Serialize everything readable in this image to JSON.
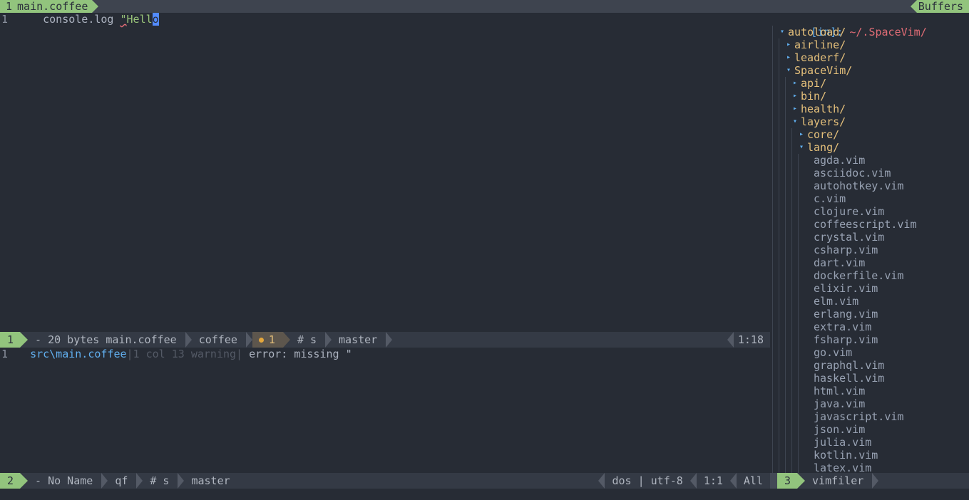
{
  "tabline": {
    "active_tab": {
      "number": "1",
      "label": "main.coffee"
    },
    "right_label": "Buffers"
  },
  "editor": {
    "lines": [
      {
        "number": "1",
        "indent": "    ",
        "code_prefix": "console.log ",
        "string_quote": "\"",
        "string_body": "Hell",
        "cursor_char": "o"
      }
    ]
  },
  "statusline_main": {
    "window_number": "1",
    "file_info": "- 20 bytes main.coffee",
    "filetype": "coffee",
    "warning_count": "1",
    "indent_info": "# s",
    "branch": "master",
    "position": "1:18"
  },
  "quickfix": {
    "lines": [
      {
        "number": "1",
        "indent": "  ",
        "file": "src\\main.coffee",
        "meta": "|1 col 13 warning|",
        "message": " error: missing \""
      }
    ]
  },
  "statusline_quickfix": {
    "window_number": "2",
    "file_info": "- No Name",
    "filetype": "qf",
    "indent_info": "# s",
    "branch": "master",
    "fileformat": "dos | utf-8",
    "position": "1:1",
    "scroll": "All"
  },
  "statusline_tree": {
    "window_number": "3",
    "label": "vimfiler"
  },
  "filetree": {
    "header_prefix": "[in]: ",
    "header_path": "~/.SpaceVim/",
    "rows": [
      {
        "depth": 0,
        "marker": "open",
        "name": "autoload/",
        "kind": "dir"
      },
      {
        "depth": 1,
        "marker": "closed",
        "name": "airline/",
        "kind": "dir"
      },
      {
        "depth": 1,
        "marker": "closed",
        "name": "leaderf/",
        "kind": "dir"
      },
      {
        "depth": 1,
        "marker": "open",
        "name": "SpaceVim/",
        "kind": "dir"
      },
      {
        "depth": 2,
        "marker": "closed",
        "name": "api/",
        "kind": "dir"
      },
      {
        "depth": 2,
        "marker": "closed",
        "name": "bin/",
        "kind": "dir"
      },
      {
        "depth": 2,
        "marker": "closed",
        "name": "health/",
        "kind": "dir"
      },
      {
        "depth": 2,
        "marker": "open",
        "name": "layers/",
        "kind": "dir"
      },
      {
        "depth": 3,
        "marker": "closed",
        "name": "core/",
        "kind": "dir"
      },
      {
        "depth": 3,
        "marker": "open",
        "name": "lang/",
        "kind": "dir"
      },
      {
        "depth": 4,
        "marker": "none",
        "name": "agda.vim",
        "kind": "file"
      },
      {
        "depth": 4,
        "marker": "none",
        "name": "asciidoc.vim",
        "kind": "file"
      },
      {
        "depth": 4,
        "marker": "none",
        "name": "autohotkey.vim",
        "kind": "file"
      },
      {
        "depth": 4,
        "marker": "none",
        "name": "c.vim",
        "kind": "file"
      },
      {
        "depth": 4,
        "marker": "none",
        "name": "clojure.vim",
        "kind": "file"
      },
      {
        "depth": 4,
        "marker": "none",
        "name": "coffeescript.vim",
        "kind": "file"
      },
      {
        "depth": 4,
        "marker": "none",
        "name": "crystal.vim",
        "kind": "file"
      },
      {
        "depth": 4,
        "marker": "none",
        "name": "csharp.vim",
        "kind": "file"
      },
      {
        "depth": 4,
        "marker": "none",
        "name": "dart.vim",
        "kind": "file"
      },
      {
        "depth": 4,
        "marker": "none",
        "name": "dockerfile.vim",
        "kind": "file"
      },
      {
        "depth": 4,
        "marker": "none",
        "name": "elixir.vim",
        "kind": "file"
      },
      {
        "depth": 4,
        "marker": "none",
        "name": "elm.vim",
        "kind": "file"
      },
      {
        "depth": 4,
        "marker": "none",
        "name": "erlang.vim",
        "kind": "file"
      },
      {
        "depth": 4,
        "marker": "none",
        "name": "extra.vim",
        "kind": "file"
      },
      {
        "depth": 4,
        "marker": "none",
        "name": "fsharp.vim",
        "kind": "file"
      },
      {
        "depth": 4,
        "marker": "none",
        "name": "go.vim",
        "kind": "file"
      },
      {
        "depth": 4,
        "marker": "none",
        "name": "graphql.vim",
        "kind": "file"
      },
      {
        "depth": 4,
        "marker": "none",
        "name": "haskell.vim",
        "kind": "file"
      },
      {
        "depth": 4,
        "marker": "none",
        "name": "html.vim",
        "kind": "file"
      },
      {
        "depth": 4,
        "marker": "none",
        "name": "java.vim",
        "kind": "file"
      },
      {
        "depth": 4,
        "marker": "none",
        "name": "javascript.vim",
        "kind": "file"
      },
      {
        "depth": 4,
        "marker": "none",
        "name": "json.vim",
        "kind": "file"
      },
      {
        "depth": 4,
        "marker": "none",
        "name": "julia.vim",
        "kind": "file"
      },
      {
        "depth": 4,
        "marker": "none",
        "name": "kotlin.vim",
        "kind": "file"
      },
      {
        "depth": 4,
        "marker": "none",
        "name": "latex.vim",
        "kind": "file"
      }
    ],
    "marker_glyphs": {
      "open": "▾",
      "closed": "▸",
      "none": " "
    }
  },
  "colors": {
    "background": "#272c35",
    "statusline_bg": "#343a45",
    "accent_green": "#92c47d",
    "dir_yellow": "#e5c07b",
    "file_gray": "#98a2b3",
    "string_green": "#98c379",
    "cursor_blue": "#528bff",
    "link_blue": "#61afef",
    "path_red": "#e06c75",
    "warn_orange": "#e5a73c"
  }
}
